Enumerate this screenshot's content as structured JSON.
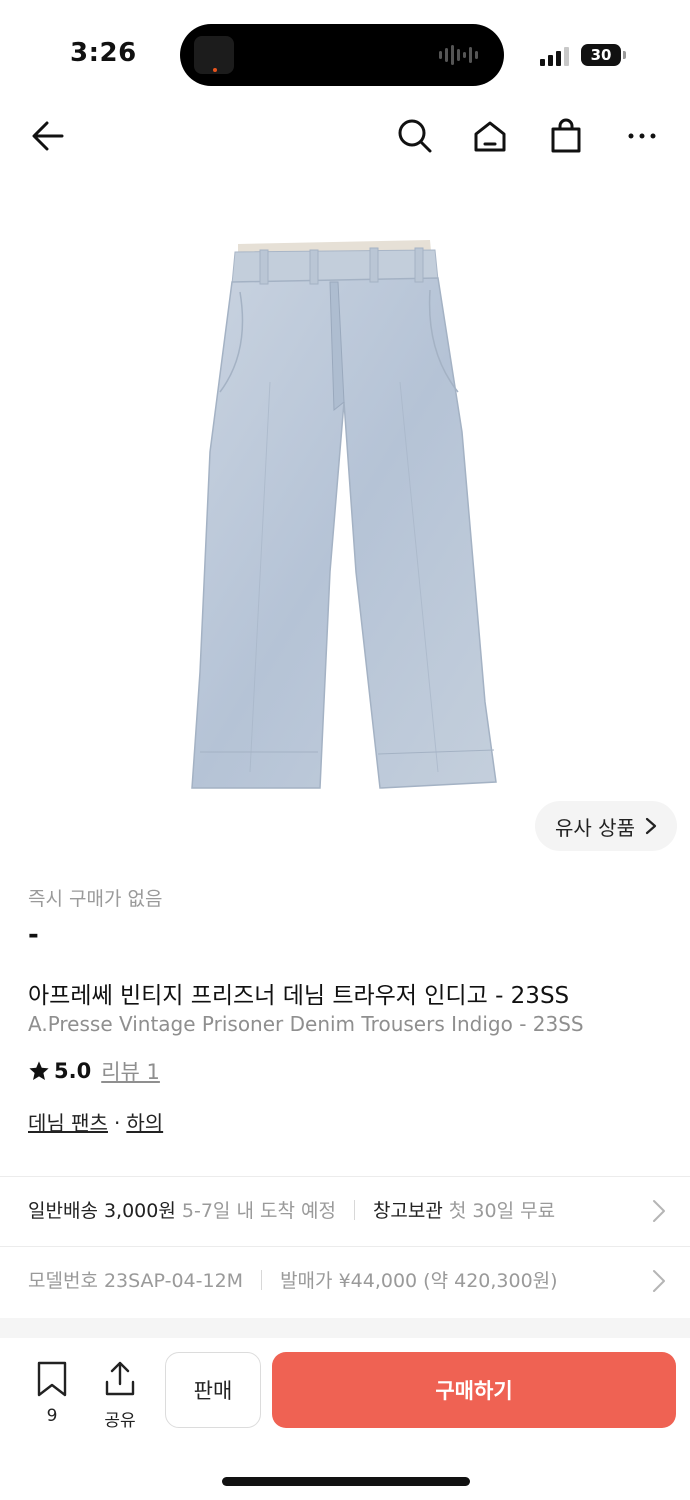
{
  "status_bar": {
    "time": "3:26",
    "battery": "30"
  },
  "nav": {
    "icons": [
      "back-arrow-icon",
      "search-icon",
      "home-icon",
      "shopping-bag-icon",
      "more-icon"
    ]
  },
  "product": {
    "image_alt": "light indigo denim trousers",
    "similar_products_label": "유사 상품",
    "instant_price_label": "즉시 구매가 없음",
    "instant_price_value": "-",
    "title_ko": "아프레쎄 빈티지 프리즈너 데님 트라우저 인디고 - 23SS",
    "title_en": "A.Presse Vintage Prisoner Denim Trousers Indigo - 23SS",
    "rating": "5.0",
    "review_label": "리뷰 1",
    "category_main": "데님 팬츠",
    "category_separator": "·",
    "category_sub": "하의"
  },
  "shipping": {
    "type_label": "일반배송",
    "fee": "3,000원",
    "eta": "5-7일 내 도착 예정",
    "storage_label": "창고보관",
    "storage_offer": "첫 30일 무료"
  },
  "model": {
    "model_label": "모델번호",
    "model_number": "23SAP-04-12M",
    "release_label": "발매가",
    "release_price": "¥44,000 (약 420,300원)"
  },
  "bottom_bar": {
    "bookmark_count": "9",
    "share_label": "공유",
    "sell_label": "판매",
    "buy_label": "구매하기"
  },
  "colors": {
    "buy_button": "#ef6253",
    "muted_text": "#9a9a9a",
    "similar_chip": "#f4f4f4"
  }
}
